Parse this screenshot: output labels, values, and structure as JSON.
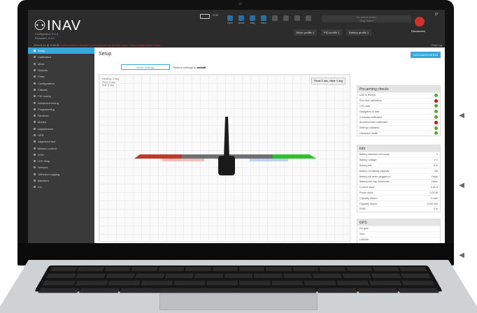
{
  "header": {
    "logo": "INAV",
    "subtitle": [
      "Configurator: 5.1.0",
      "Firmware: 5.1.0"
    ],
    "battery_voltage": "0.0V",
    "sensors": [
      {
        "label": "Gyro",
        "active": true
      },
      {
        "label": "Accel",
        "active": true
      },
      {
        "label": "Mag",
        "active": true
      },
      {
        "label": "Baro",
        "active": true
      },
      {
        "label": "",
        "active": false
      },
      {
        "label": "",
        "active": false
      },
      {
        "label": "",
        "active": false
      },
      {
        "label": "",
        "active": false
      }
    ],
    "message_lines": [
      "No active profile",
      "Only board"
    ],
    "profiles": [
      "Mixer profile 1",
      "PID profile 1",
      "Battery profile 1"
    ],
    "disconnect_label": "Disconnect",
    "zero": "0°"
  },
  "statusbar": {
    "time": "2024-11-12 @ 12:54:30",
    "warning": "Profile contains a disabled devices and has not yet been saved. Save changes before reboot.",
    "show_log": "Show Log"
  },
  "sidebar": {
    "items": [
      {
        "label": "Setup",
        "active": true
      },
      {
        "label": "Calibration"
      },
      {
        "label": "Mixer"
      },
      {
        "label": "Outputs"
      },
      {
        "label": "Ports"
      },
      {
        "label": "Configuration"
      },
      {
        "label": "Failsafe"
      },
      {
        "label": "PID tuning"
      },
      {
        "label": "Advanced tuning"
      },
      {
        "label": "Programming"
      },
      {
        "label": "Receiver"
      },
      {
        "label": "Modes"
      },
      {
        "label": "Adjustments"
      },
      {
        "label": "GPS"
      },
      {
        "label": "Alignment tool"
      },
      {
        "label": "Mission control"
      },
      {
        "label": "OSD"
      },
      {
        "label": "LED Strip"
      },
      {
        "label": "Sensors"
      },
      {
        "label": "Tethered Logging"
      },
      {
        "label": "Blackbox"
      },
      {
        "label": "CLI"
      }
    ]
  },
  "main": {
    "title": "Setup",
    "documentation": "DOCUMENTATION",
    "reset_settings": "Reset Settings",
    "restore_text": "Restore settings to",
    "restore_bold": "default",
    "heading": "Heading: 0 deg",
    "pitch": "Pitch: 0 deg",
    "roll": "Roll: 0 deg",
    "reset_z": "Reset Z axis, offset: 0 deg"
  },
  "prearm": {
    "title": "Pre-arming checks",
    "rows": [
      {
        "label": "UAV is leveled",
        "ok": true
      },
      {
        "label": "Run-time calibration",
        "ok": false
      },
      {
        "label": "CPU load",
        "ok": true
      },
      {
        "label": "Navigation is safe",
        "ok": true
      },
      {
        "label": "Compass calibrated",
        "ok": true
      },
      {
        "label": "Accelerometer calibrated",
        "ok": false
      },
      {
        "label": "Settings validated",
        "ok": true
      },
      {
        "label": "Hardware health",
        "ok": true
      }
    ]
  },
  "info": {
    "title": "Info",
    "rows": [
      {
        "label": "Battery detected cell count:",
        "value": "0"
      },
      {
        "label": "Battery voltage:",
        "value": "0 V"
      },
      {
        "label": "Battery left:",
        "value": "0 %"
      },
      {
        "label": "Battery remaining capacity:",
        "value": "NA"
      },
      {
        "label": "Battery full when plugged in:",
        "value": "False"
      },
      {
        "label": "Battery use cap thresholds:",
        "value": "False"
      },
      {
        "label": "Current draw:",
        "value": "0.00 A"
      },
      {
        "label": "Power draw:",
        "value": "0.00 W"
      },
      {
        "label": "Capacity drawn:",
        "value": "0 mAh"
      },
      {
        "label": "Capacity drawn:",
        "value": "0.000 Wh"
      },
      {
        "label": "RSSI:",
        "value": "0 %"
      }
    ]
  },
  "gps": {
    "title": "GPS",
    "rows": [
      {
        "label": "Fix type:"
      },
      {
        "label": "Sats:"
      },
      {
        "label": "Latitude:"
      },
      {
        "label": "Longitude:"
      }
    ]
  }
}
